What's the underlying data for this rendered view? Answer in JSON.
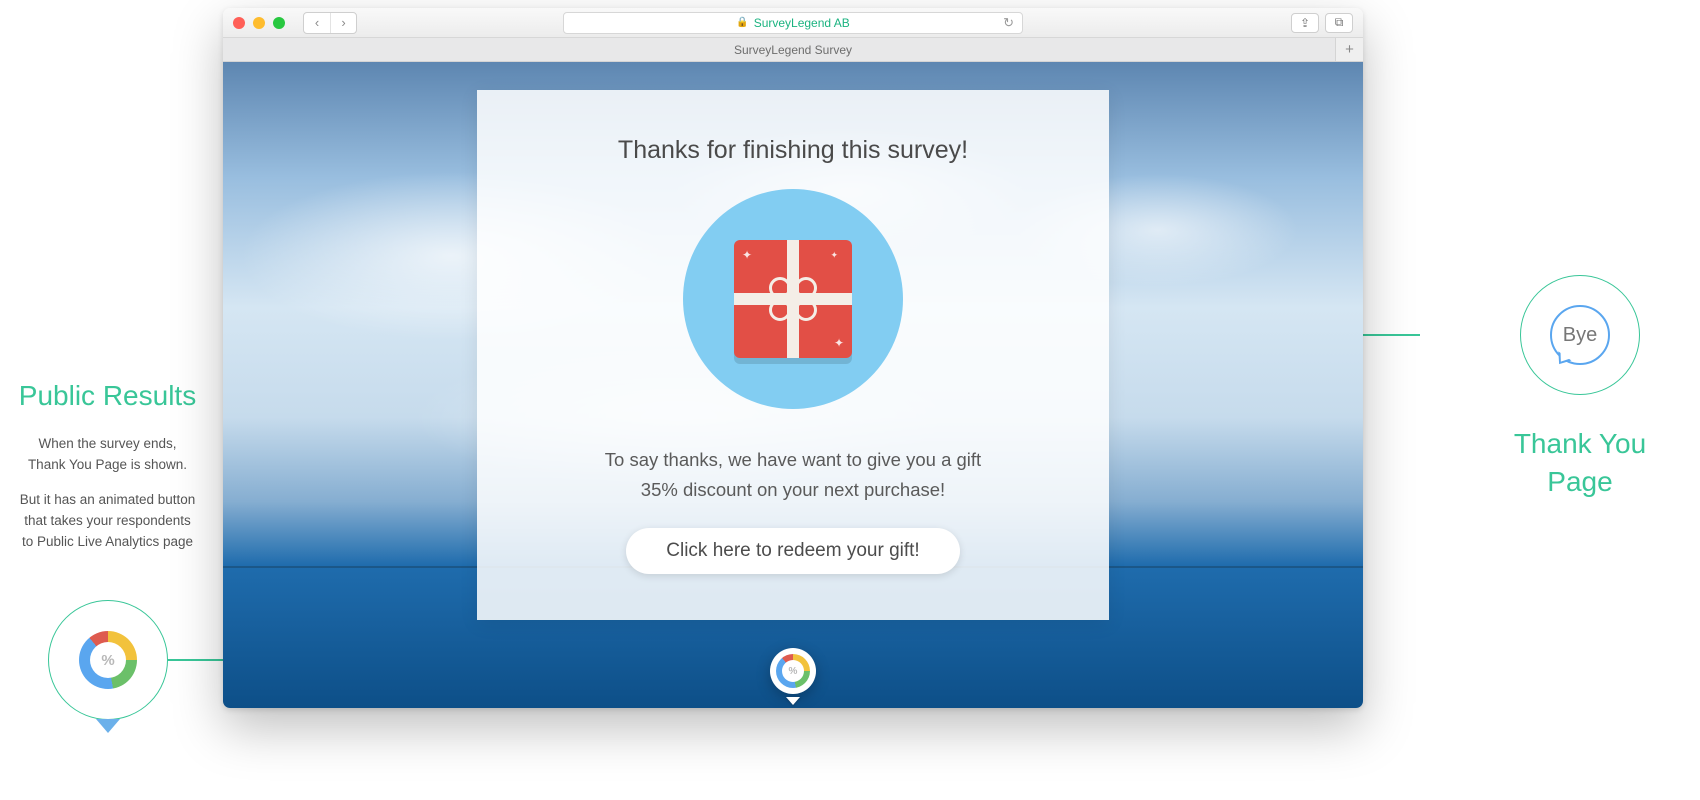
{
  "left_annotation": {
    "title": "Public Results",
    "p1_line1": "When the survey ends,",
    "p1_line2": "Thank You Page is shown.",
    "p2_line1": "But it has an animated button",
    "p2_line2": "that takes your respondents",
    "p2_line3": "to Public Live Analytics page",
    "badge_symbol": "%"
  },
  "right_annotation": {
    "title_line1": "Thank You",
    "title_line2": "Page",
    "bubble_text": "Bye"
  },
  "browser": {
    "address_text": "SurveyLegend AB",
    "tab_title": "SurveyLegend Survey",
    "back_glyph": "‹",
    "forward_glyph": "›",
    "reload_glyph": "↻",
    "share_glyph": "⇪",
    "tabs_glyph": "⧉",
    "newtab_glyph": "+",
    "lock_glyph": "🔒"
  },
  "card": {
    "heading": "Thanks for finishing this survey!",
    "body_line1": "To say thanks, we have want to give you a gift",
    "body_line2": "35% discount on your next purchase!",
    "cta_label": "Click here to redeem your gift!"
  },
  "results_btn": {
    "symbol": "%"
  },
  "colors": {
    "accent_green": "#39c698",
    "gift_red": "#e24f46",
    "circle_blue": "#82cdf2"
  }
}
